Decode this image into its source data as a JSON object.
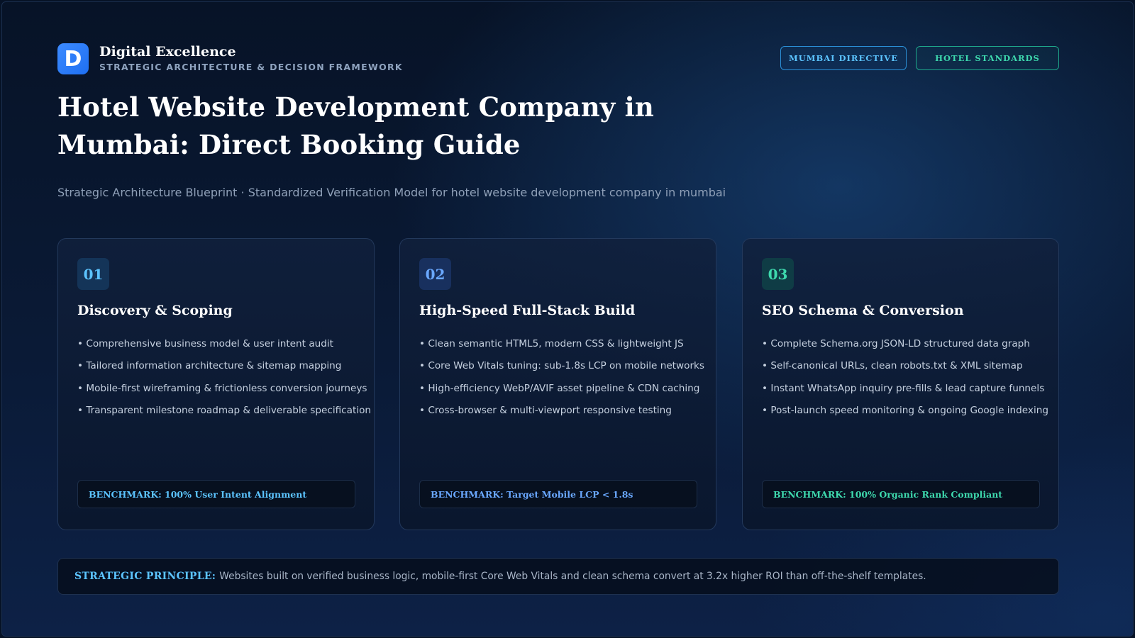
{
  "brand": {
    "logo_letter": "D",
    "name": "Digital Excellence",
    "tagline": "STRATEGIC ARCHITECTURE & DECISION FRAMEWORK"
  },
  "badges": [
    "MUMBAI DIRECTIVE",
    "HOTEL STANDARDS"
  ],
  "title": "Hotel Website Development Company in Mumbai: Direct Booking Guide",
  "subtitle": "Strategic Architecture Blueprint · Standardized Verification Model for hotel website development company in mumbai",
  "cards": [
    {
      "number": "01",
      "title": "Discovery & Scoping",
      "items": [
        "• Comprehensive business model & user intent audit",
        "• Tailored information architecture & sitemap mapping",
        "• Mobile-first wireframing & frictionless conversion journeys",
        "• Transparent milestone roadmap & deliverable specification"
      ],
      "benchmark": "BENCHMARK: 100% User Intent Alignment"
    },
    {
      "number": "02",
      "title": "High-Speed Full-Stack Build",
      "items": [
        "• Clean semantic HTML5, modern CSS & lightweight JS",
        "• Core Web Vitals tuning: sub-1.8s LCP on mobile networks",
        "• High-efficiency WebP/AVIF asset pipeline & CDN caching",
        "• Cross-browser & multi-viewport responsive testing"
      ],
      "benchmark": "BENCHMARK: Target Mobile LCP < 1.8s"
    },
    {
      "number": "03",
      "title": "SEO Schema & Conversion",
      "items": [
        "• Complete Schema.org JSON-LD structured data graph",
        "• Self-canonical URLs, clean robots.txt & XML sitemap",
        "• Instant WhatsApp inquiry pre-fills & lead capture funnels",
        "• Post-launch speed monitoring & ongoing Google indexing"
      ],
      "benchmark": "BENCHMARK: 100% Organic Rank Compliant"
    }
  ],
  "principle": {
    "label": "STRATEGIC PRINCIPLE:",
    "text": "Websites built on verified business logic, mobile-first Core Web Vitals and clean schema convert at 3.2x higher ROI than off-the-shelf templates."
  },
  "colors": {
    "accent_blue": "#5cc4ff",
    "accent_indigo": "#6aa8ff",
    "accent_green": "#3ed9ae",
    "background": "#0a1a36"
  }
}
